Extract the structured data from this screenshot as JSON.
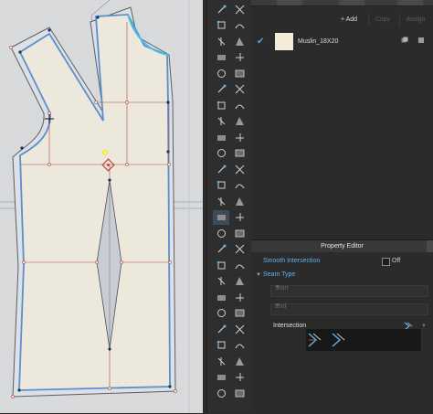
{
  "canvas": {
    "background": "#d9dadc",
    "pattern_fill": "#ece8dc",
    "seam_line": "#5a8fd0",
    "internal_line": "#b04848",
    "selected_point": "#ffff33"
  },
  "tools": [
    "tool-icon-1",
    "tool-icon-2",
    "tool-icon-3",
    "tool-icon-4",
    "tool-icon-5",
    "tool-icon-6",
    "tool-icon-7",
    "tool-icon-8",
    "tool-icon-9",
    "tool-icon-10",
    "tool-icon-11",
    "tool-icon-12",
    "tool-icon-13",
    "tool-icon-14",
    "tool-icon-15",
    "tool-icon-16",
    "tool-icon-17",
    "tool-icon-18",
    "tool-icon-19",
    "tool-icon-20",
    "tool-icon-21",
    "tool-icon-22",
    "tool-icon-23",
    "tool-icon-24",
    "tool-icon-25",
    "tool-icon-26",
    "tool-icon-27",
    "tool-icon-28",
    "tool-icon-29",
    "tool-icon-30",
    "tool-icon-31",
    "tool-icon-32",
    "tool-icon-33",
    "tool-icon-34",
    "tool-icon-35",
    "tool-icon-36",
    "tool-icon-37",
    "tool-icon-38",
    "tool-icon-39",
    "tool-icon-40",
    "tool-icon-41",
    "tool-icon-42",
    "tool-icon-43",
    "tool-icon-44",
    "tool-icon-45",
    "tool-icon-46",
    "tool-icon-47",
    "tool-icon-48",
    "tool-icon-49",
    "tool-icon-50"
  ],
  "fabric_panel": {
    "add_label": "+ Add",
    "copy_label": "Copy",
    "assign_label": "Assign",
    "fabric": {
      "name": "Muslin_18X20",
      "swatch_color": "#f3ecd9",
      "checked": true
    }
  },
  "property_editor": {
    "title": "Property Editor",
    "smooth_intersection": {
      "label": "Smooth Intersection",
      "value": "Off"
    },
    "seam_type": {
      "label": "Seam Type",
      "start_label": "Start",
      "end_label": "End",
      "intersection_label": "Intersection"
    }
  }
}
